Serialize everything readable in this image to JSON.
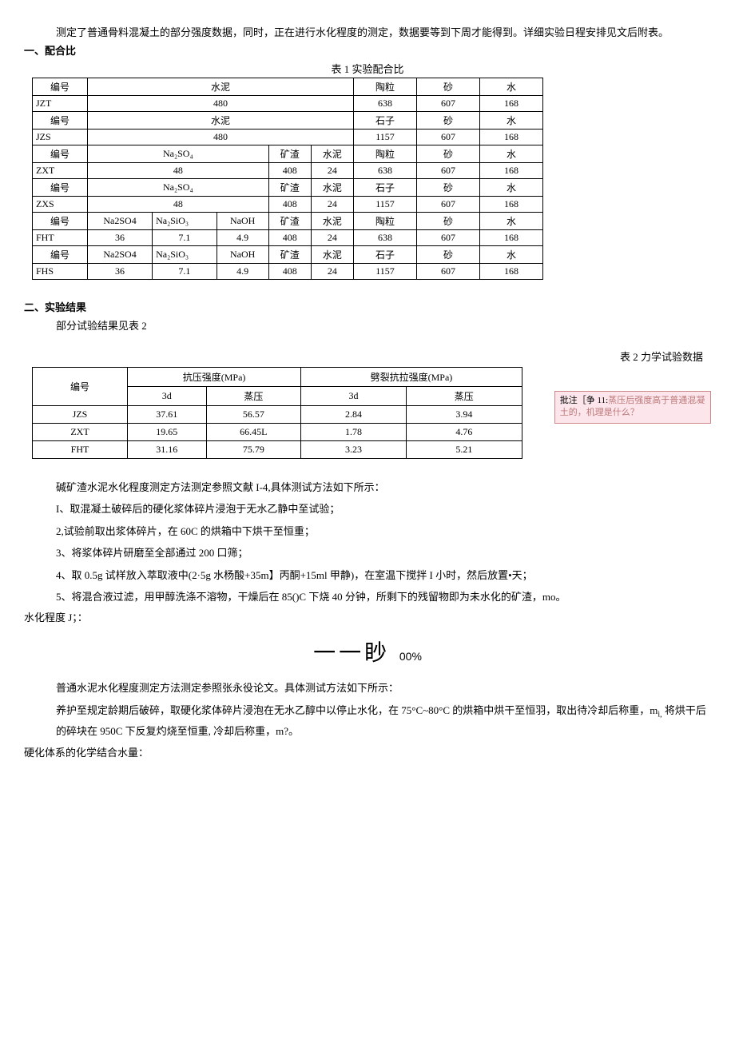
{
  "intro": "测定了普通骨料混凝土的部分强度数据，同时，正在进行水化程度的测定，数据要等到下周才能得到。详细实验日程安排见文后附表。",
  "sec1_title": "一、配合比",
  "table1_caption": "表 1 实验配合比",
  "t1": {
    "r1": {
      "c1": "编号",
      "c2": "水泥",
      "c3": "陶粒",
      "c4": "砂",
      "c5": "水"
    },
    "r2": {
      "c1": "JZT",
      "c2": "480",
      "c3": "638",
      "c4": "607",
      "c5": "168"
    },
    "r3": {
      "c1": "编号",
      "c2": "水泥",
      "c3": "石子",
      "c4": "砂",
      "c5": "水"
    },
    "r4": {
      "c1": "JZS",
      "c2": "480",
      "c3": "1157",
      "c4": "607",
      "c5": "168"
    },
    "r5": {
      "c1": "编号",
      "c2": "Na₂SO₄",
      "c3": "矿渣",
      "c4": "水泥",
      "c5": "陶粒",
      "c6": "砂",
      "c7": "水"
    },
    "r6": {
      "c1": "ZXT",
      "c2": "48",
      "c3": "408",
      "c4": "24",
      "c5": "638",
      "c6": "607",
      "c7": "168"
    },
    "r7": {
      "c1": "编号",
      "c2": "Na₂SO₄",
      "c3": "矿渣",
      "c4": "水泥",
      "c5": "石子",
      "c6": "砂",
      "c7": "水"
    },
    "r8": {
      "c1": "ZXS",
      "c2": "48",
      "c3": "408",
      "c4": "24",
      "c5": "1157",
      "c6": "607",
      "c7": "168"
    },
    "r9": {
      "c1": "编号",
      "c2": "Na2SO4",
      "c3": "Na₂SiO₃",
      "c4": "NaOH",
      "c5": "矿渣",
      "c6": "水泥",
      "c7": "陶粒",
      "c8": "砂",
      "c9": "水"
    },
    "r10": {
      "c1": "FHT",
      "c2": "36",
      "c3": "7.1",
      "c4": "4.9",
      "c5": "408",
      "c6": "24",
      "c7": "638",
      "c8": "607",
      "c9": "168"
    },
    "r11": {
      "c1": "编号",
      "c2": "Na2SO4",
      "c3": "Na₂SiO₃",
      "c4": "NaOH",
      "c5": "矿渣",
      "c6": "水泥",
      "c7": "石子",
      "c8": "砂",
      "c9": "水"
    },
    "r12": {
      "c1": "FHS",
      "c2": "36",
      "c3": "7.1",
      "c4": "4.9",
      "c5": "408",
      "c6": "24",
      "c7": "1157",
      "c8": "607",
      "c9": "168"
    }
  },
  "sec2_title": "二、实验结果",
  "results_note": "部分试验结果见表 2",
  "table2_label": "表 2 力学试验数据",
  "t2": {
    "h1": "编号",
    "h2": "抗压强度(MPa)",
    "h3": "劈裂抗拉强度(MPa)",
    "sh1": "3d",
    "sh2": "蒸压",
    "sh3": "3d",
    "sh4": "蒸压",
    "rows": [
      {
        "id": "JZS",
        "a": "37.61",
        "b": "56.57",
        "c": "2.84",
        "d": "3.94"
      },
      {
        "id": "ZXT",
        "a": "19.65",
        "b": "66.45L",
        "c": "1.78",
        "d": "4.76"
      },
      {
        "id": "FHT",
        "a": "31.16",
        "b": "75.79",
        "c": "3.23",
        "d": "5.21"
      }
    ]
  },
  "comment_lead": "批注［争 11:",
  "comment_body": "蒸压后强度高于普通混凝土的，机理是什么？",
  "method_intro": "碱矿渣水泥水化程度测定方法测定参照文献 I-4,具体测试方法如下所示：",
  "steps": [
    "I、取混凝土破碎后的硬化浆体碎片浸泡于无水乙静中至试验；",
    "2,试验前取出浆体碎片，在 60C 的烘箱中下烘干至恒重；",
    "3、将浆体碎片研磨至全部通过 200 口筛；",
    "4、取 0.5g 试样放入萃取液中(2·5g 水杨酸+35m】丙酮+15ml 甲静)，在室温下搅拌 I 小时，然后放置•天；",
    "5、将混合液过滤，用甲醇洗涤不溶物，干燥后在 85()C 下烧 40 分钟，所剩下的残留物即为未水化的矿渣，mo。"
  ],
  "hyd_label": "水化程度 J；：",
  "formula": "一一眇",
  "formula_suffix": "00%",
  "para2": "普通水泥水化程度测定方法测定参照张永役论文。具体测试方法如下所示：",
  "para3_a": "养护至规定龄期后破碎，取硬化浆体碎片浸泡在无水乙醇中以停止水化，在 75°C~80°C 的烘箱中烘干至恒羽，取出待冷却后称重，m",
  "para3_sub": "i,",
  "para3_b": " 将烘干后的碎块在 950C 下反复灼烧至恒重, 冷却后称重，m?。",
  "para4": "硬化体系的化学结合水量："
}
